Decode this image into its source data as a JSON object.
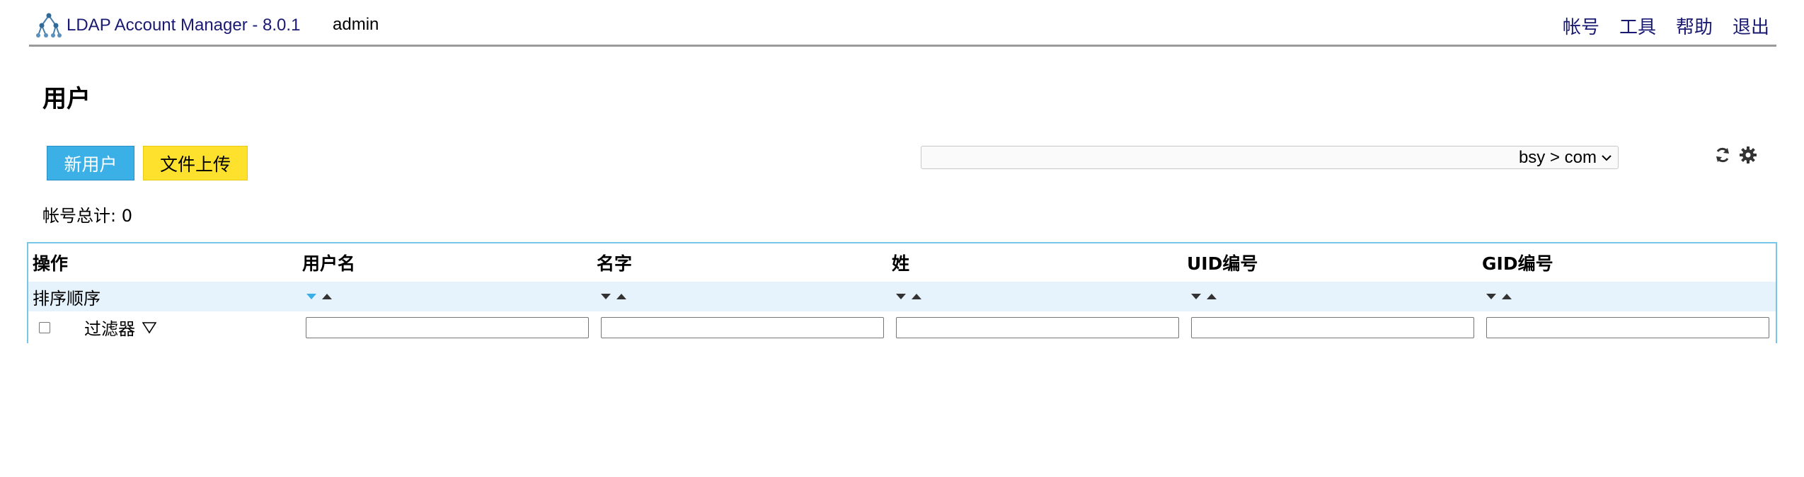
{
  "header": {
    "app_title": "LDAP Account Manager - 8.0.1",
    "user": "admin",
    "menu": [
      "帐号",
      "工具",
      "帮助",
      "退出"
    ]
  },
  "page": {
    "title": "用户"
  },
  "toolbar": {
    "new_user_label": "新用户",
    "upload_label": "文件上传",
    "suffix_selected": "bsy > com"
  },
  "count": {
    "label": "帐号总计: 0"
  },
  "table": {
    "columns": [
      "操作",
      "用户名",
      "名字",
      "姓",
      "UID编号",
      "GID编号"
    ],
    "sort_label": "排序顺序",
    "filter_label": "过滤器",
    "active_sort_column": "用户名",
    "colors": {
      "border": "#79c5e8",
      "sort_row_bg": "#e6f3fc",
      "active_arrow": "#3ab0e7",
      "inactive_arrow": "#333333"
    }
  },
  "icons": {
    "logo": "ldap-tree-icon",
    "refresh": "refresh-icon",
    "settings": "gear-icon",
    "filter": "funnel-icon"
  }
}
